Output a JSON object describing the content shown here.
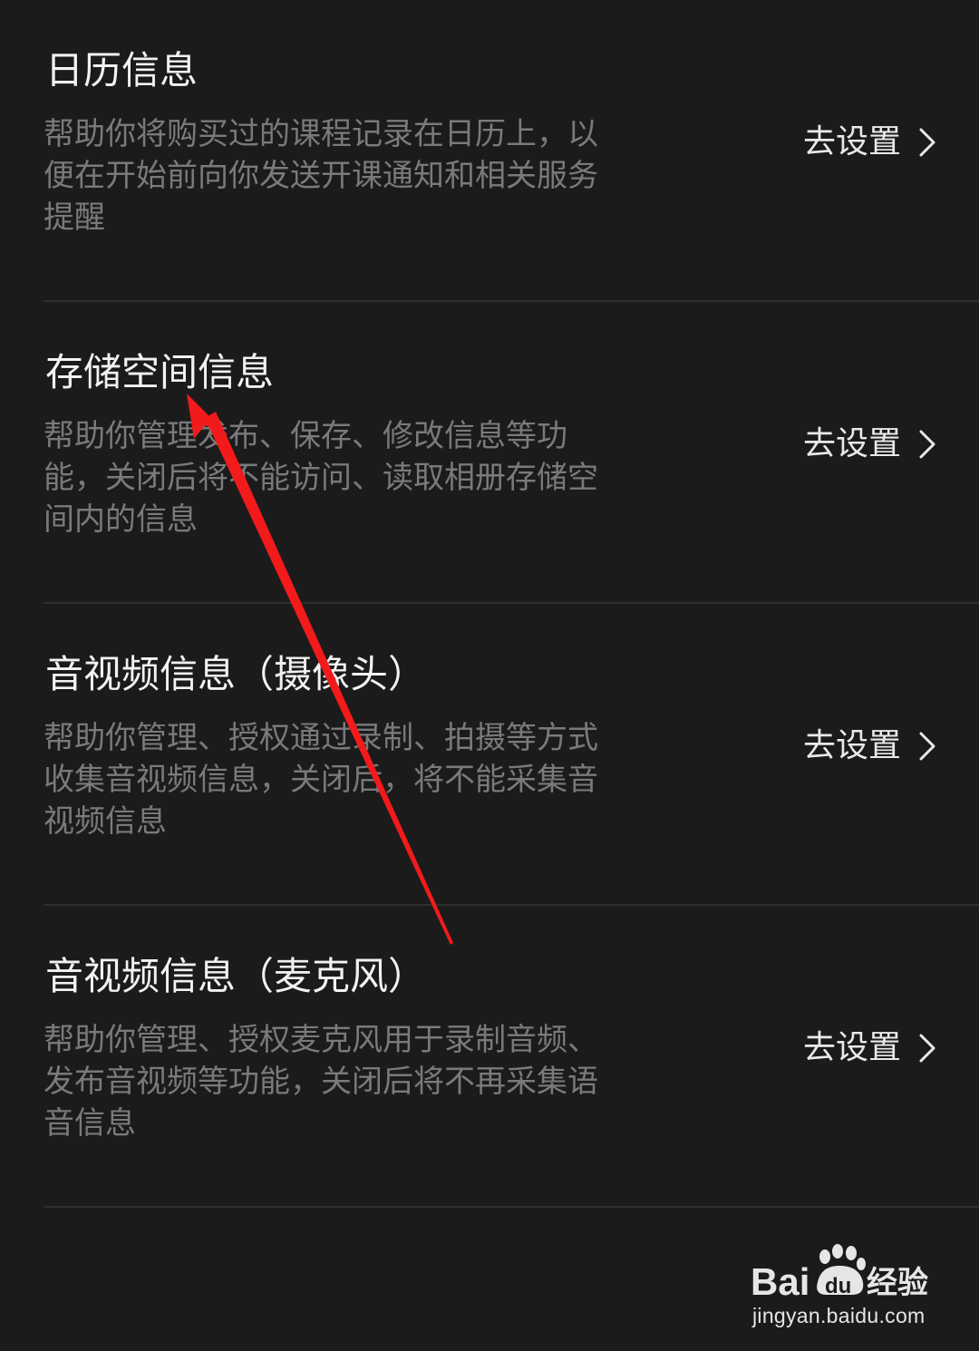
{
  "sections": [
    {
      "title": "日历信息",
      "description_lines": [
        "帮助你将购买过的课程记录在日历上，以",
        "便在开始前向你发送开课通知和相关服务",
        "提醒"
      ],
      "action_label": "去设置"
    },
    {
      "title": "存储空间信息",
      "description_lines": [
        "帮助你管理发布、保存、修改信息等功",
        "能，关闭后将不能访问、读取相册存储空",
        "间内的信息"
      ],
      "action_label": "去设置"
    },
    {
      "title": "音视频信息（摄像头）",
      "description_lines": [
        "帮助你管理、授权通过录制、拍摄等方式",
        "收集音视频信息，关闭后，将不能采集音",
        "视频信息"
      ],
      "action_label": "去设置"
    },
    {
      "title": "音视频信息（麦克风）",
      "description_lines": [
        "帮助你管理、授权麦克风用于录制音频、",
        "发布音视频等功能，关闭后将不再采集语",
        "音信息"
      ],
      "action_label": "去设置"
    }
  ],
  "icons": {
    "chevron": "chevron-right-icon",
    "annotation": "red-arrow"
  },
  "colors": {
    "background": "#1b1b1c",
    "title": "#f2f2f2",
    "description": "#7a7a7c",
    "action": "#e9e9e9",
    "divider": "#2e2e2f",
    "annotation": "#f21a1a"
  },
  "watermark": {
    "brand": "Baidu经验",
    "url": "jingyan.baidu.com"
  }
}
